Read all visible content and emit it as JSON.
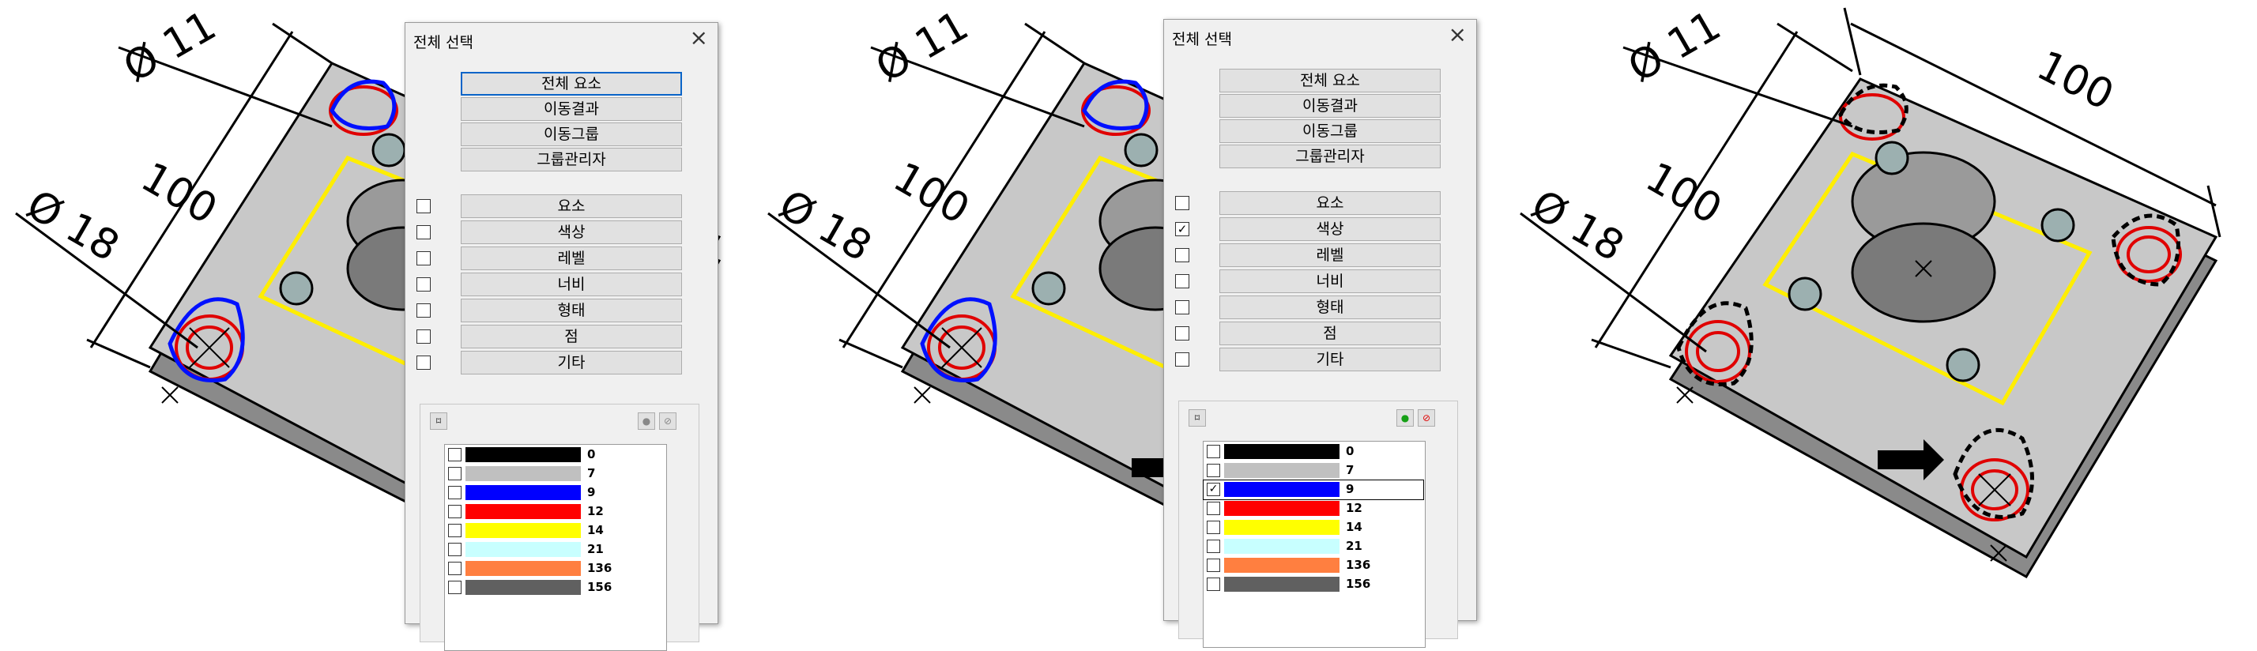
{
  "dialog": {
    "title": "전체 선택",
    "close_glyph": "×",
    "buttons": [
      "전체 요소",
      "이동결과",
      "이동그룹",
      "그룹관리자"
    ],
    "filters": [
      "요소",
      "색상",
      "레벨",
      "너비",
      "형태",
      "점",
      "기타"
    ],
    "toolbar_left_icon": "select-icon",
    "toolbar_right_icons": [
      "add-icon",
      "remove-icon"
    ]
  },
  "colors": [
    {
      "value": "0",
      "hex": "#000000"
    },
    {
      "value": "7",
      "hex": "#c0c0c0"
    },
    {
      "value": "9",
      "hex": "#0000ff"
    },
    {
      "value": "12",
      "hex": "#ff0000"
    },
    {
      "value": "14",
      "hex": "#ffff00"
    },
    {
      "value": "21",
      "hex": "#c8ffff"
    },
    {
      "value": "136",
      "hex": "#ff7f40"
    },
    {
      "value": "156",
      "hex": "#606060"
    }
  ],
  "dimensions": {
    "d1": "Ø 11",
    "d2": "100",
    "d3": "Ø 18",
    "top": "100"
  },
  "state": {
    "panel1": {
      "filters_checked": [],
      "color_checked": []
    },
    "panel2": {
      "filters_checked": [
        "색상"
      ],
      "color_checked": [
        "9"
      ]
    }
  }
}
